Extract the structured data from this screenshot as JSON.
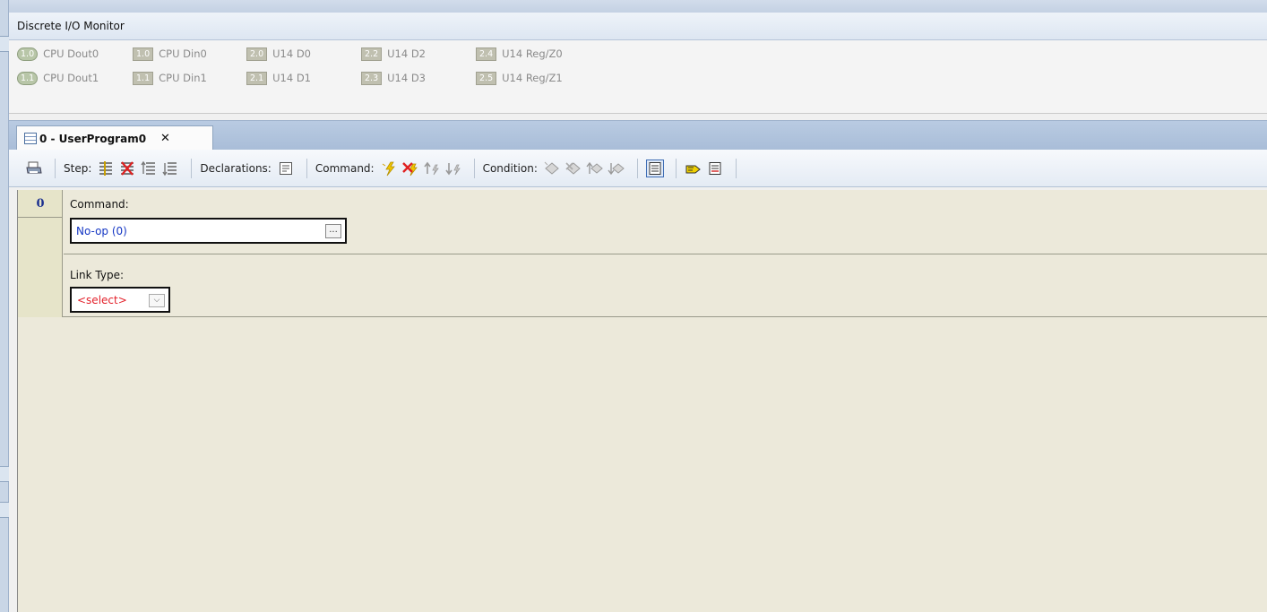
{
  "io_monitor": {
    "title": "Discrete I/O Monitor",
    "items": [
      {
        "led": "1.0",
        "label": "CPU Dout0"
      },
      {
        "led": "1.1",
        "label": "CPU Dout1"
      },
      {
        "led": "1.0",
        "label": "CPU Din0"
      },
      {
        "led": "1.1",
        "label": "CPU Din1"
      },
      {
        "led": "2.0",
        "label": "U14 D0"
      },
      {
        "led": "2.1",
        "label": "U14 D1"
      },
      {
        "led": "2.2",
        "label": "U14 D2"
      },
      {
        "led": "2.3",
        "label": "U14 D3"
      },
      {
        "led": "2.4",
        "label": "U14 Reg/Z0"
      },
      {
        "led": "2.5",
        "label": "U14 Reg/Z1"
      }
    ]
  },
  "tab": {
    "label": "0 - UserProgram0",
    "close": "✕"
  },
  "toolbar": {
    "step_label": "Step:",
    "declarations_label": "Declarations:",
    "command_label": "Command:",
    "condition_label": "Condition:"
  },
  "step": {
    "number": "0",
    "command_label": "Command:",
    "command_value": "No-op (0)",
    "ellipsis": "...",
    "link_type_label": "Link Type:",
    "link_type_value": "<select>",
    "dropdown_arrow": "⌵"
  },
  "icons": {
    "print": "print-icon",
    "step_insert": "step-insert-icon",
    "step_delete": "step-delete-icon",
    "step_up": "step-move-up-icon",
    "step_down": "step-move-down-icon",
    "declarations": "declarations-icon",
    "command_add": "command-add-icon",
    "command_delete": "command-delete-icon",
    "command_up": "command-move-up-icon",
    "command_down": "command-move-down-icon",
    "condition_add": "condition-add-icon",
    "condition_delete": "condition-delete-icon",
    "condition_up": "condition-move-up-icon",
    "condition_down": "condition-move-down-icon",
    "view_list": "list-view-icon",
    "view_tag": "tag-view-icon",
    "view_notes": "notes-view-icon"
  },
  "colors": {
    "command_value": "#1537c4",
    "link_value": "#e3202a",
    "canvas": "#ece9da",
    "step_number": "#1a2f8f"
  }
}
